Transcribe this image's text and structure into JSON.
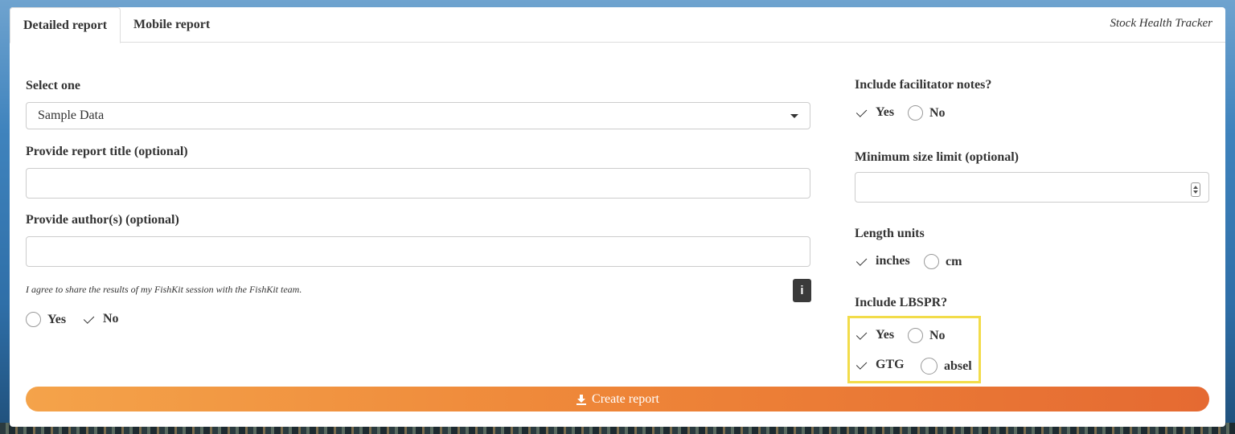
{
  "tabs": [
    {
      "label": "Detailed report",
      "active": true
    },
    {
      "label": "Mobile report",
      "active": false
    }
  ],
  "app_title": "Stock Health Tracker",
  "form": {
    "select_label": "Select one",
    "select_value": "Sample Data",
    "report_title_label": "Provide report title (optional)",
    "report_title_value": "",
    "authors_label": "Provide author(s) (optional)",
    "authors_value": "",
    "consent_text": "I agree to share the results of my FishKit session with the FishKit team.",
    "info_icon": "i",
    "consent_yes": "Yes",
    "consent_no": "No",
    "consent_selected": "No"
  },
  "right": {
    "notes_label": "Include facilitator notes?",
    "notes_yes": "Yes",
    "notes_no": "No",
    "notes_selected": "Yes",
    "min_size_label": "Minimum size limit (optional)",
    "min_size_value": "",
    "units_label": "Length units",
    "units_inches": "inches",
    "units_cm": "cm",
    "units_selected": "inches",
    "lbspr_label": "Include LBSPR?",
    "lbspr_yes": "Yes",
    "lbspr_no": "No",
    "lbspr_selected": "Yes",
    "model_gtg": "GTG",
    "model_absel": "absel",
    "model_selected": "GTG"
  },
  "create_button": "Create report",
  "colors": {
    "highlight": "#f2dc4a",
    "button_start": "#f4a34a",
    "button_end": "#e56a32"
  }
}
